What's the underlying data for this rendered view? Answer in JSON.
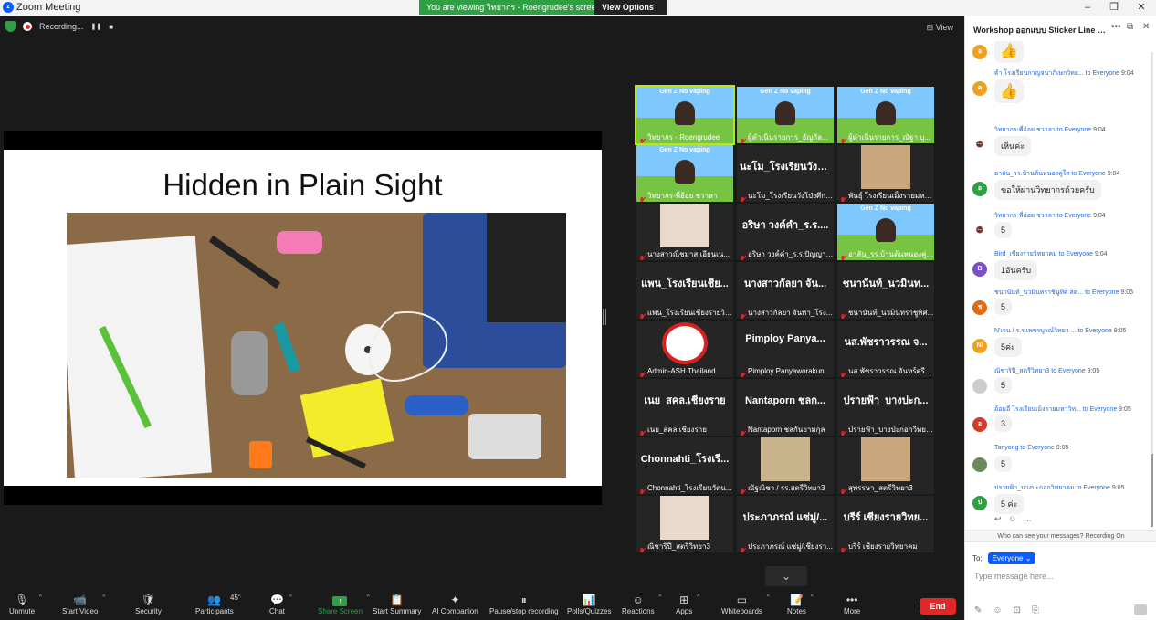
{
  "window": {
    "title": "Zoom Meeting",
    "min": "–",
    "max": "❐",
    "close": "✕"
  },
  "viewing": {
    "text": "You are viewing วิทยากร - Roengrudee's screen",
    "options": "View Options"
  },
  "recording": {
    "label": "Recording...",
    "pause": "❚❚",
    "stop": "■"
  },
  "view_button": "View",
  "slide": {
    "title": "Hidden in Plain Sight"
  },
  "gallery": {
    "tiles": [
      {
        "big": "",
        "name": "วิทยากร - Roengrudee",
        "kind": "video"
      },
      {
        "big": "",
        "name": "ผู้ดำเนินรายการ_ธัญกัล...",
        "kind": "video"
      },
      {
        "big": "",
        "name": "ผู้ดำเนินรายการ_ณัฐา บุ...",
        "kind": "video"
      },
      {
        "big": "",
        "name": "วิทยากร-พี่อ้อย ชวาลา",
        "kind": "video"
      },
      {
        "big": "นะโม_โรงเรียนวังโ...",
        "name": "นะโม_โรงเรียนวังโป่งศึกษา",
        "kind": "text"
      },
      {
        "big": "",
        "name": "พันธุ์ โรงเรียนเม็งรายมหาร...",
        "kind": "photo"
      },
      {
        "big": "",
        "name": "นางสาวณิชมาส เอียนเน...",
        "kind": "photo"
      },
      {
        "big": "อริษา วงค์คำ_ร.ร....",
        "name": "อริษา วงค์คำ_ร.ร.ปัญญาว...",
        "kind": "text"
      },
      {
        "big": "",
        "name": "อาลัน_รร.บ้านต้นหนองคู่ใส",
        "kind": "video"
      },
      {
        "big": "แพน_โรงเรียนเชีย...",
        "name": "แพน_โรงเรียนเชียงรายวิท...",
        "kind": "text"
      },
      {
        "big": "นางสาวกัลยา จัน...",
        "name": "นางสาวกัลยา จันทา_โรง...",
        "kind": "text"
      },
      {
        "big": "ชนานันท์_นวมินท...",
        "name": "ชนานันท์_นวมินทราชูทิศ...",
        "kind": "text"
      },
      {
        "big": "",
        "name": "Admin-ASH Thailand",
        "kind": "nosmoke"
      },
      {
        "big": "Pimploy Panya...",
        "name": "Pimploy Panyaworakun",
        "kind": "text"
      },
      {
        "big": "นส.พัชราวรรณ จ...",
        "name": "นส.พัชราวรรณ จันทร์ศรี...",
        "kind": "text"
      },
      {
        "big": "เนย_สคล.เชียงราย",
        "name": "เนย_สคล.เชียงราย",
        "kind": "text"
      },
      {
        "big": "Nantaporn ชลก...",
        "name": "Nantaporn ชลกันยามกุล",
        "kind": "text"
      },
      {
        "big": "ปรายฟ้า_บางปะก...",
        "name": "ปรายฟ้า_บางปะกอกวิทยา...",
        "kind": "text"
      },
      {
        "big": "Chonnahti_โรงเรี...",
        "name": "Chonnahti_โรงเรียนวัดน...",
        "kind": "text"
      },
      {
        "big": "",
        "name": "ณัฐณิชา / รร.สตรีวิทยา3",
        "kind": "photo"
      },
      {
        "big": "",
        "name": "สุพรรษา_สตรีวิทยา3",
        "kind": "photo"
      },
      {
        "big": "",
        "name": "ณิชาริปี_สตรีวิทยา3",
        "kind": "photo"
      },
      {
        "big": "ประภาภรณ์ แซ่มู่/...",
        "name": "ประภาภรณ์ แซ่มู่/เชียงรา...",
        "kind": "text"
      },
      {
        "big": "บรีร์ เชียงรายวิทย...",
        "name": "บรีร์ เชียงรายวิทยาคม",
        "kind": "text"
      }
    ],
    "gen_text": "Gen Z No vaping",
    "scroll": "⌄"
  },
  "toolbar": {
    "items": [
      {
        "label": "Unmute",
        "icon": "🎙"
      },
      {
        "label": "Start Video",
        "icon": "📹"
      },
      {
        "label": "Security",
        "icon": "🛡"
      },
      {
        "label": "Participants",
        "icon": "👥",
        "count": "45"
      },
      {
        "label": "Chat",
        "icon": "💬"
      },
      {
        "label": "Share Screen",
        "icon": "↑"
      },
      {
        "label": "Start Summary",
        "icon": "📋"
      },
      {
        "label": "AI Companion",
        "icon": "✦"
      },
      {
        "label": "Pause/stop recording",
        "icon": "⏸"
      },
      {
        "label": "Polls/Quizzes",
        "icon": "📊"
      },
      {
        "label": "Reactions",
        "icon": "☺"
      },
      {
        "label": "Apps",
        "icon": "⊞"
      },
      {
        "label": "Whiteboards",
        "icon": "▭"
      },
      {
        "label": "Notes",
        "icon": "📝"
      },
      {
        "label": "More",
        "icon": "•••"
      }
    ],
    "end": "End"
  },
  "chat": {
    "title": "Workshop ออกแบบ Sticker Line G...",
    "messages": [
      {
        "who": "",
        "to": "",
        "time": "",
        "text": "👍",
        "emoji": true,
        "color": "#f0a020",
        "initial": "อ"
      },
      {
        "who": "ต้า โรงเรียนกาญจนาภิเษกวิทย...",
        "to": "to Everyone",
        "time": "9:04",
        "text": "👍",
        "emoji": true,
        "color": "#f0a020",
        "initial": "ต"
      },
      {
        "who": "วิทยากร-พี่อ้อย ชวาลา",
        "to": "to Everyone",
        "time": "9:04",
        "text": "เห็นค่ะ",
        "emoji": false,
        "color": "#fff",
        "initial": "🚭"
      },
      {
        "who": "อาลัน_รร.บ้านต้นหนองคู่ใส",
        "to": "to Everyone",
        "time": "9:04",
        "text": "ขอให้ผ่านวิทยากรด้วยครับ",
        "emoji": false,
        "color": "#2ea043",
        "initial": "อ"
      },
      {
        "who": "วิทยากร-พี่อ้อย ชวาลา",
        "to": "to Everyone",
        "time": "9:04",
        "text": "5",
        "emoji": false,
        "color": "#fff",
        "initial": "🚭"
      },
      {
        "who": "Bird_เชียงรายวิทยาคม",
        "to": "to Everyone",
        "time": "9:04",
        "text": "1อันครับ",
        "emoji": false,
        "color": "#7a4fc7",
        "initial": "B"
      },
      {
        "who": "ชนานันท์_นวมินทราชินูทิศ สต...",
        "to": "to Everyone",
        "time": "9:05",
        "text": "5",
        "emoji": false,
        "color": "#e06a14",
        "initial": "ช"
      },
      {
        "who": "N'เจน / ร.ร.เพชรบูรณ์วิทยา ...",
        "to": "to Everyone",
        "time": "9:05",
        "text": "5ค่ะ",
        "emoji": false,
        "color": "#f0a020",
        "initial": "N/"
      },
      {
        "who": "ณิชาริปี_สตรีวิทยา3",
        "to": "to Everyone",
        "time": "9:05",
        "text": "5",
        "emoji": false,
        "color": "#ccc",
        "initial": ""
      },
      {
        "who": "อ้อมอี่ โรงเรียนเม็งรายมหาวิท...",
        "to": "to Everyone",
        "time": "9:05",
        "text": "3",
        "emoji": false,
        "color": "#d23a2a",
        "initial": "อ"
      },
      {
        "who": "Tanyong",
        "to": "to Everyone",
        "time": "9:05",
        "text": "5",
        "emoji": false,
        "color": "#6a8a5a",
        "initial": ""
      },
      {
        "who": "ปรายฟ้า_บางปะกอกวิทยาคม",
        "to": "to Everyone",
        "time": "9:05",
        "text": "5 ค่ะ",
        "emoji": false,
        "color": "#2ea043",
        "initial": "ป"
      }
    ],
    "who_can_see": "Who can see your messages? Recording On",
    "to_label": "To:",
    "to_value": "Everyone ⌄",
    "placeholder": "Type message here..."
  }
}
